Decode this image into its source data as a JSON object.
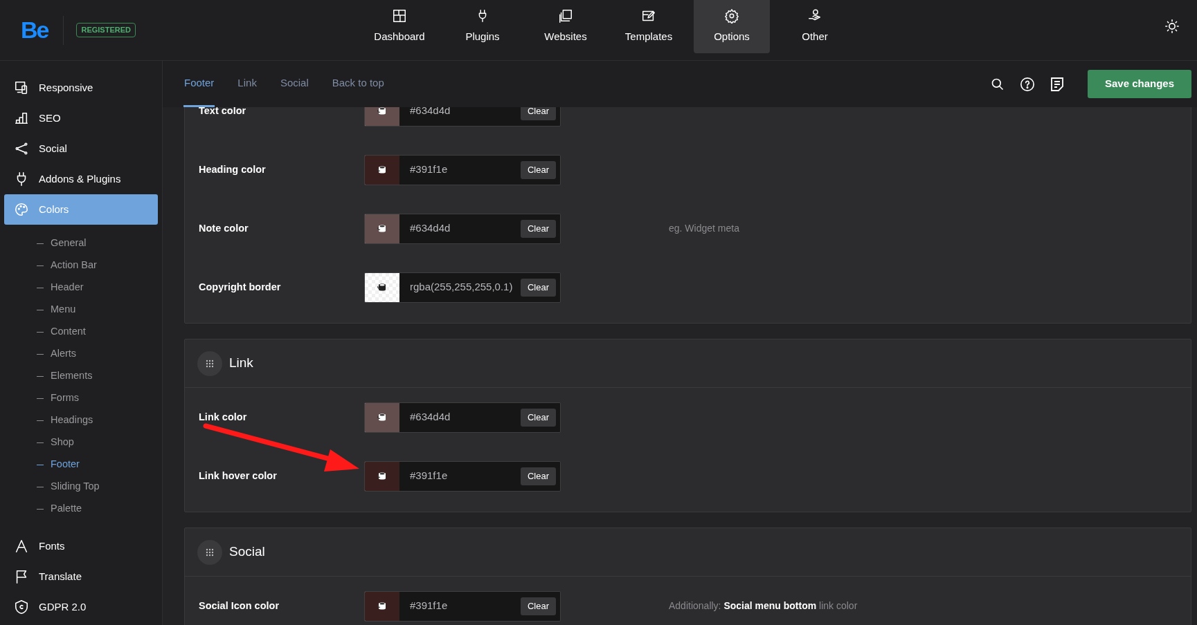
{
  "logo": {
    "text": "Be",
    "badge": "REGISTERED"
  },
  "top_nav": [
    {
      "label": "Dashboard",
      "selected": false
    },
    {
      "label": "Plugins",
      "selected": false
    },
    {
      "label": "Websites",
      "selected": false
    },
    {
      "label": "Templates",
      "selected": false
    },
    {
      "label": "Options",
      "selected": true
    },
    {
      "label": "Other",
      "selected": false
    }
  ],
  "sidebar": {
    "items": [
      {
        "label": "Responsive",
        "selected": false
      },
      {
        "label": "SEO",
        "selected": false
      },
      {
        "label": "Social",
        "selected": false
      },
      {
        "label": "Addons & Plugins",
        "selected": false
      },
      {
        "label": "Colors",
        "selected": true,
        "children": [
          {
            "label": "General",
            "selected": false
          },
          {
            "label": "Action Bar",
            "selected": false
          },
          {
            "label": "Header",
            "selected": false
          },
          {
            "label": "Menu",
            "selected": false
          },
          {
            "label": "Content",
            "selected": false
          },
          {
            "label": "Alerts",
            "selected": false
          },
          {
            "label": "Elements",
            "selected": false
          },
          {
            "label": "Forms",
            "selected": false
          },
          {
            "label": "Headings",
            "selected": false
          },
          {
            "label": "Shop",
            "selected": false
          },
          {
            "label": "Footer",
            "selected": true
          },
          {
            "label": "Sliding Top",
            "selected": false
          },
          {
            "label": "Palette",
            "selected": false
          }
        ]
      },
      {
        "label": "Fonts",
        "selected": false
      },
      {
        "label": "Translate",
        "selected": false
      },
      {
        "label": "GDPR 2.0",
        "selected": false
      }
    ]
  },
  "tabs": [
    {
      "label": "Footer",
      "selected": true
    },
    {
      "label": "Link",
      "selected": false
    },
    {
      "label": "Social",
      "selected": false
    },
    {
      "label": "Back to top",
      "selected": false
    }
  ],
  "save_button": "Save changes",
  "sections": [
    {
      "rows": [
        {
          "label": "Text color",
          "value": "#634d4d",
          "clear": "Clear"
        },
        {
          "label": "Heading color",
          "value": "#391f1e",
          "clear": "Clear"
        },
        {
          "label": "Note color",
          "value": "#634d4d",
          "clear": "Clear",
          "hint": "eg. Widget meta"
        },
        {
          "label": "Copyright border",
          "value": "rgba(255,255,255,0.1)",
          "clear": "Clear"
        }
      ]
    },
    {
      "title": "Link",
      "rows": [
        {
          "label": "Link color",
          "value": "#634d4d",
          "clear": "Clear"
        },
        {
          "label": "Link hover color",
          "value": "#391f1e",
          "clear": "Clear"
        }
      ]
    },
    {
      "title": "Social",
      "rows": [
        {
          "label": "Social Icon color",
          "value": "#391f1e",
          "clear": "Clear",
          "hint": "Additionally: **Social menu bottom** link color"
        }
      ]
    }
  ]
}
